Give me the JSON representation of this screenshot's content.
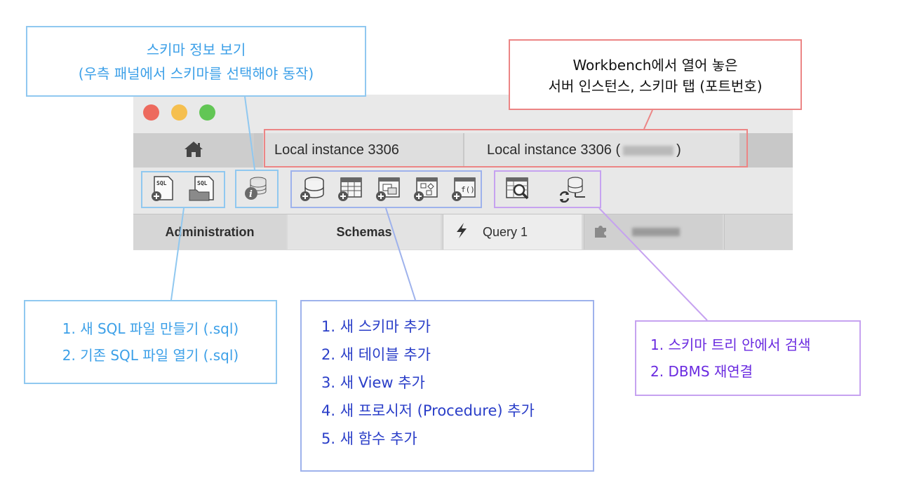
{
  "window": {
    "tabs": [
      {
        "label": "Local instance 3306"
      },
      {
        "label_prefix": "Local instance 3306 (",
        "label_suffix": ")"
      }
    ],
    "toolbar": {
      "icons": [
        "new-sql-file-icon",
        "open-sql-file-icon",
        "schema-inspector-icon",
        "create-schema-icon",
        "create-table-icon",
        "create-view-icon",
        "create-procedure-icon",
        "create-function-icon",
        "search-table-data-icon",
        "reconnect-dbms-icon"
      ]
    },
    "subtabs": {
      "administration": "Administration",
      "schemas": "Schemas",
      "query": "Query 1"
    }
  },
  "annotations": {
    "schema_info": [
      "스키마 정보 보기",
      "(우측 패널에서 스키마를 선택해야 동작)"
    ],
    "tabs": [
      "Workbench에서 열어 놓은",
      "서버 인스턴스, 스키마 탭 (포트번호)"
    ],
    "sql_files": [
      "1. 새 SQL 파일 만들기 (.sql)",
      "2. 기존 SQL 파일 열기 (.sql)"
    ],
    "create_objects": [
      "1. 새 스키마 추가",
      "2. 새 테이블 추가",
      "3. 새 View 추가",
      "4. 새 프로시저 (Procedure) 추가",
      "5. 새 함수 추가"
    ],
    "tools": [
      "1. 스키마 트리 안에서 검색",
      "2. DBMS 재연결"
    ]
  },
  "colors": {
    "blue_note": "#3ca0e8",
    "red_note": "#ec8585",
    "indigo_note": "#2a3ec8",
    "purple_note": "#6a2ae0"
  }
}
